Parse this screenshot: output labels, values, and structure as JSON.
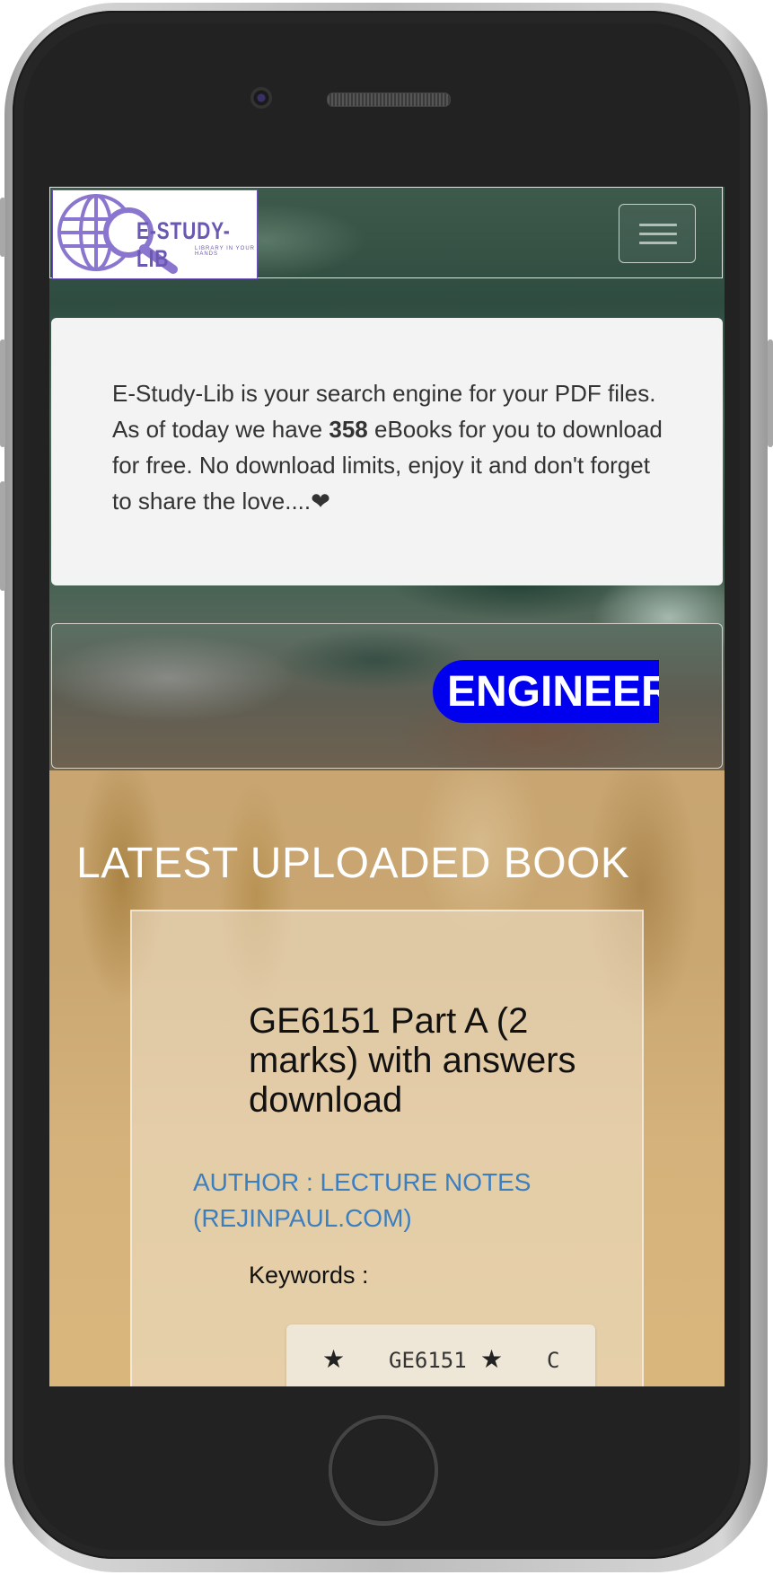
{
  "site": {
    "brand": "E-STUDY-LIB",
    "tagline": "LIBRARY IN YOUR HANDS"
  },
  "intro": {
    "text_before": "E-Study-Lib is your search engine for your PDF files. As of today we have ",
    "book_count": "358",
    "text_after": " eBooks for you to download for free. No download limits, enjoy it and don't forget to share the love....",
    "heart_icon": "❤"
  },
  "ticker": {
    "category": "ENGINEERING",
    "pill_color": "#0000ee"
  },
  "latest": {
    "heading": "LATEST UPLOADED BOOK",
    "book": {
      "title": "GE6151 Part A (2 marks) with answers download",
      "author": "AUTHOR : LECTURE NOTES (REJINPAUL.COM)",
      "keywords_label": "Keywords :",
      "keywords": [
        "GE6151",
        "C"
      ]
    }
  },
  "colors": {
    "author_link": "#3c7fbf",
    "logo_purple": "#6b58b3"
  }
}
